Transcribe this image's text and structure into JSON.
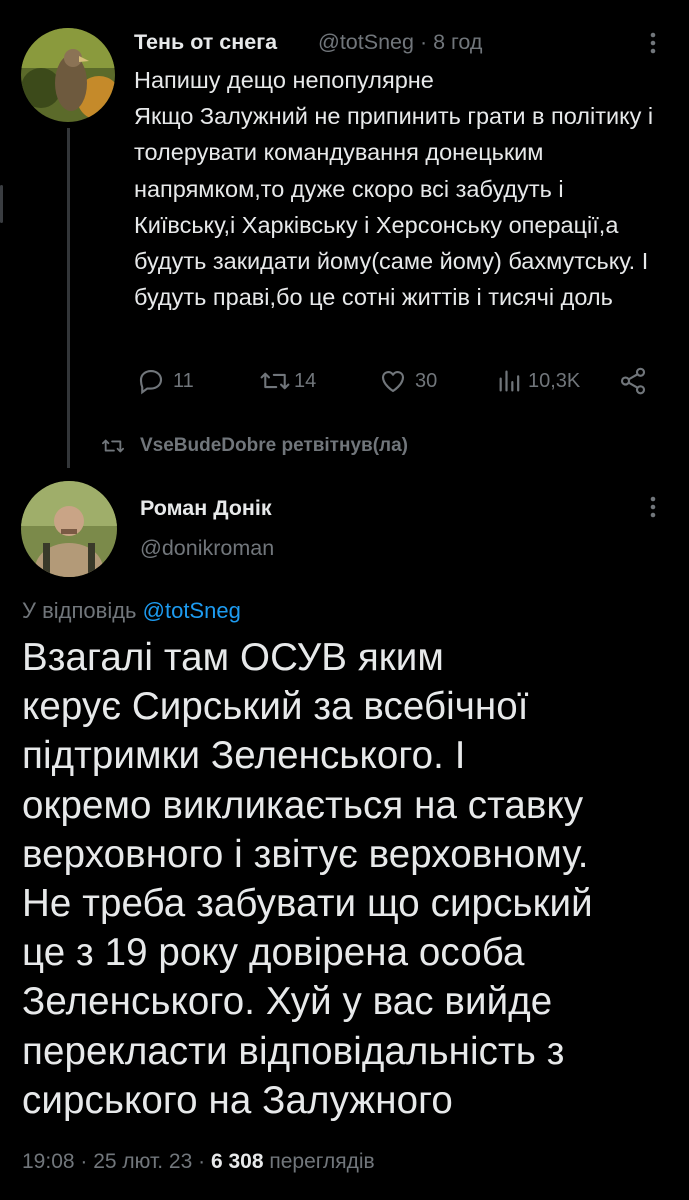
{
  "tweet1": {
    "display_name": "Тень от снега",
    "handle": "@totSneg",
    "separator": "·",
    "time": "8 год",
    "text": "Напишу дещо непопулярне\nЯкщо Залужний не припинить грати в політику і толерувати командування донецьким напрямком,то дуже скоро всі забудуть і Київську,і Харківську і Херсонську операції,а будуть закидати йому(саме йому) бахмутську. І будуть праві,бо це сотні життів і тисячі доль",
    "replies": "11",
    "retweets": "14",
    "likes": "30",
    "views": "10,3K"
  },
  "retweet_note": "VseBudeDobre ретвітнув(ла)",
  "tweet2": {
    "display_name": "Роман Донік",
    "handle": "@donikroman",
    "reply_prefix": "У відповідь ",
    "reply_handle": "@totSneg",
    "text": "Взагалі там ОСУВ яким\nкерує Сирський за всебічної\nпідтримки Зеленського. І\nокремо викликається на ставку\nверховного і звітує верховному.\nНе треба забувати що сирський\nце з 19 року довірена особа\nЗеленського. Хуй у вас вийде\nперекласти відповідальність з\nсирського на Залужного",
    "time": "19:08",
    "date": "25 лют. 23",
    "views_count": "6 308",
    "views_label": "перегля­дів"
  },
  "icons": {
    "more": "more-vertical-icon",
    "reply": "reply-icon",
    "retweet": "retweet-icon",
    "like": "heart-icon",
    "views": "views-icon",
    "share": "share-icon"
  }
}
